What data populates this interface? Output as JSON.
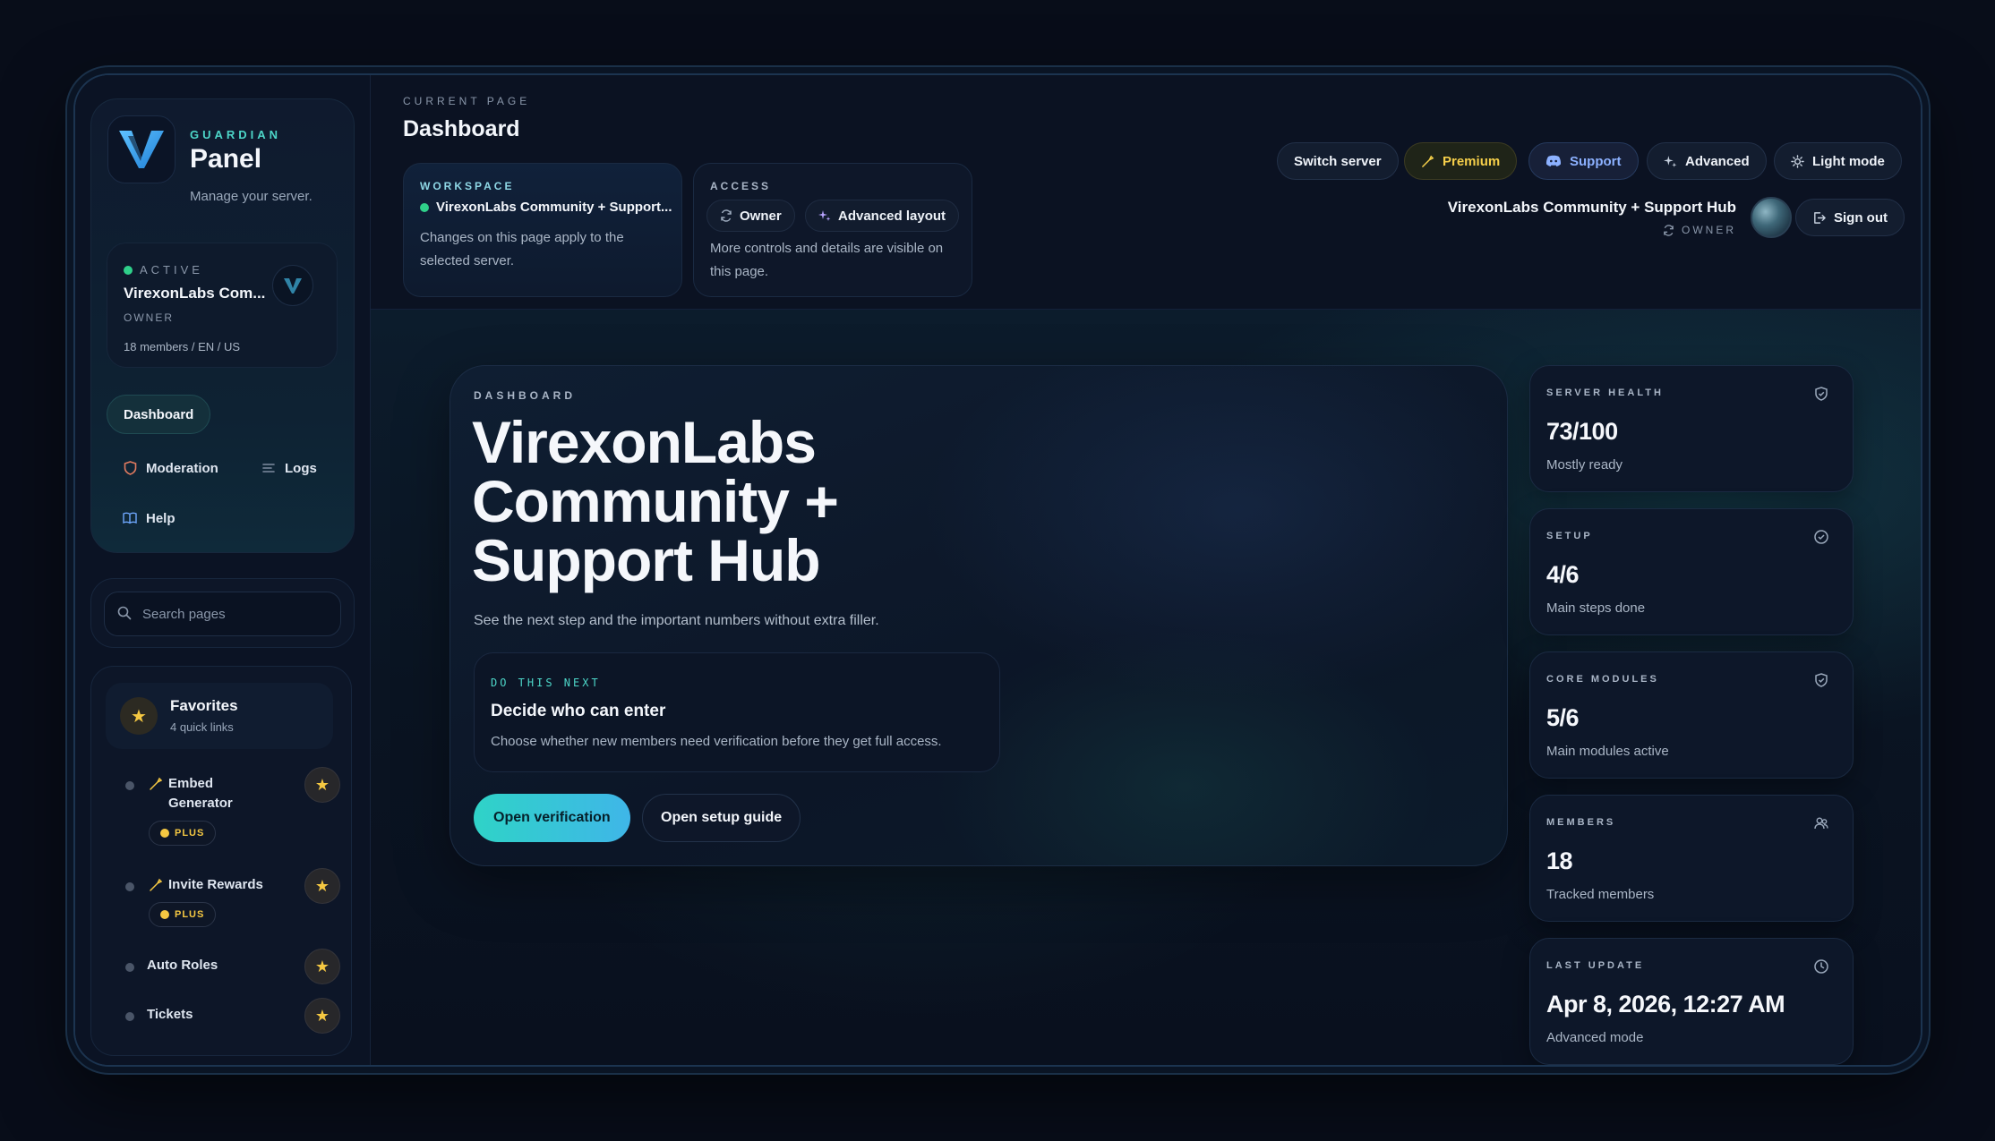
{
  "sidebar": {
    "brand_small": "GUARDIAN",
    "brand_big": "Panel",
    "brand_sub": "Manage your server.",
    "active": {
      "label": "ACTIVE",
      "name": "VirexonLabs Com...",
      "role": "OWNER",
      "meta": "18 members / EN / US"
    },
    "nav": {
      "dashboard": "Dashboard",
      "moderation": "Moderation",
      "logs": "Logs",
      "help": "Help"
    },
    "search_placeholder": "Search pages",
    "favorites": {
      "title": "Favorites",
      "sub": "4 quick links",
      "items": [
        {
          "name": "Embed",
          "name2": "Generator",
          "badge": "PLUS"
        },
        {
          "name": "Invite Rewards",
          "badge": "PLUS"
        },
        {
          "name": "Auto Roles"
        },
        {
          "name": "Tickets"
        }
      ]
    }
  },
  "header": {
    "current_label": "CURRENT PAGE",
    "title": "Dashboard",
    "workspace": {
      "label": "WORKSPACE",
      "name": "VirexonLabs Community + Support...",
      "desc": "Changes on this page apply to the selected server."
    },
    "access": {
      "label": "ACCESS",
      "owner": "Owner",
      "advanced": "Advanced layout",
      "desc": "More controls and details are visible on this page."
    },
    "buttons": {
      "switch_server": "Switch server",
      "premium": "Premium",
      "support": "Support",
      "advanced": "Advanced",
      "light_mode": "Light mode",
      "sign_out": "Sign out"
    },
    "server_name": "VirexonLabs Community + Support Hub",
    "server_role": "OWNER"
  },
  "hero": {
    "label": "DASHBOARD",
    "title": "VirexonLabs Community + Support Hub",
    "sub": "See the next step and the important numbers without extra filler.",
    "next": {
      "label": "DO THIS NEXT",
      "title": "Decide who can enter",
      "desc": "Choose whether new members need verification before they get full access."
    },
    "primary_btn": "Open verification",
    "secondary_btn": "Open setup guide"
  },
  "stats": [
    {
      "label": "SERVER HEALTH",
      "value": "73/100",
      "sub": "Mostly ready",
      "icon": "shield-icon"
    },
    {
      "label": "SETUP",
      "value": "4/6",
      "sub": "Main steps done",
      "icon": "check-circle-icon"
    },
    {
      "label": "CORE MODULES",
      "value": "5/6",
      "sub": "Main modules active",
      "icon": "shield-check-icon"
    },
    {
      "label": "MEMBERS",
      "value": "18",
      "sub": "Tracked members",
      "icon": "users-icon"
    },
    {
      "label": "LAST UPDATE",
      "value": "Apr 8, 2026, 12:27 AM",
      "sub": "Advanced mode",
      "icon": "clock-icon"
    }
  ],
  "colors": {
    "accent": "#4dd6c8",
    "premium": "#f5cf4a",
    "support": "#8cb1ff",
    "active_dot": "#2fd08a"
  }
}
